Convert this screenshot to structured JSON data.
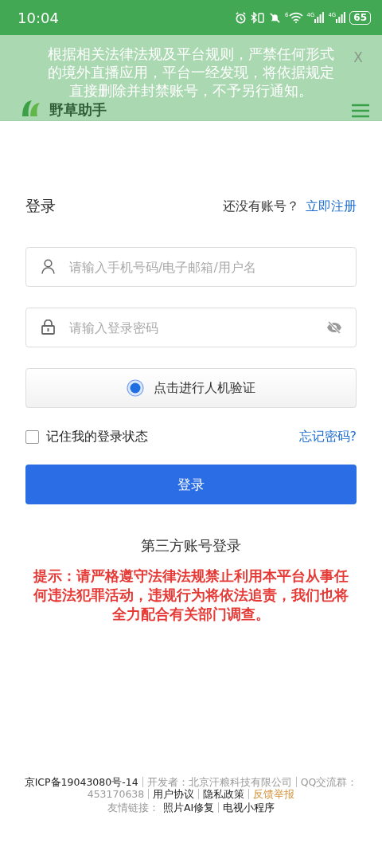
{
  "status_bar": {
    "time": "10:04",
    "wifi_tag": "6",
    "signals": [
      "4G",
      "4G"
    ],
    "battery": "65"
  },
  "header": {
    "title": "野草助手"
  },
  "toast": {
    "lines": [
      "根据相关法律法规及平台规则，严禁任何形式",
      "的境外直播应用，平台一经发现，将依据规定",
      "直接删除并封禁账号，不予另行通知。"
    ],
    "close": "X"
  },
  "login": {
    "title": "登录",
    "no_account": "还没有账号？",
    "register": "立即注册",
    "username": {
      "placeholder": "请输入手机号码/电子邮箱/用户名"
    },
    "password": {
      "placeholder": "请输入登录密码"
    },
    "captcha": "点击进行人机验证",
    "remember": {
      "label": "记住我的登录状态",
      "checked": false
    },
    "forgot": "忘记密码?",
    "submit": "登录",
    "third_party": "第三方账号登录",
    "notice": "提示：请严格遵守法律法规禁止利用本平台从事任何违法犯罪活动，违规行为将依法追责，我们也将全力配合有关部门调查。"
  },
  "footer": {
    "lines": [
      [
        {
          "text": "京ICP备19043080号-14",
          "kind": "link"
        },
        {
          "text": "开发者：北京汗粮科技有限公司",
          "kind": "info"
        },
        {
          "text": "QQ交流群：",
          "kind": "info"
        }
      ],
      [
        {
          "text": "453170638",
          "kind": "info"
        },
        {
          "text": "用户协议",
          "kind": "link"
        },
        {
          "text": "隐私政策",
          "kind": "link"
        },
        {
          "text": "反馈举报",
          "kind": "report"
        }
      ],
      [
        {
          "text": "友情链接：",
          "kind": "label"
        },
        {
          "text": "照片AI修复",
          "kind": "link"
        },
        {
          "text": "电视小程序",
          "kind": "link"
        }
      ]
    ]
  }
}
